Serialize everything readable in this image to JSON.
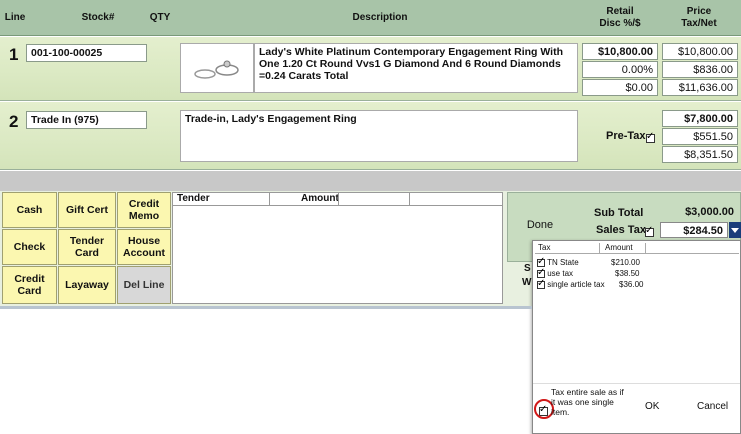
{
  "header": {
    "line": "Line",
    "stock": "Stock#",
    "qty": "QTY",
    "description": "Description",
    "retail": "Retail",
    "disc": "Disc %/$",
    "price": "Price",
    "taxnet": "Tax/Net"
  },
  "lines": [
    {
      "num": "1",
      "stock": "001-100-00025",
      "description": "Lady's White Platinum Contemporary Engagement Ring With One 1.20 Ct Round Vvs1 G Diamond And 6 Round Diamonds =0.24 Carats Total",
      "retail": "$10,800.00",
      "disc_pct": "0.00%",
      "disc_amt": "$0.00",
      "price": "$10,800.00",
      "tax": "$836.00",
      "net": "$11,636.00"
    },
    {
      "num": "2",
      "stock": "Trade In (975)",
      "description": "Trade-in, Lady's Engagement Ring",
      "pretax_label": "Pre-Tax",
      "price": "$7,800.00",
      "tax": "$551.50",
      "net": "$8,351.50"
    }
  ],
  "buttons": {
    "cash": "Cash",
    "gift_cert": "Gift Cert",
    "credit_memo": "Credit Memo",
    "check": "Check",
    "tender_card": "Tender Card",
    "house_account": "House Account",
    "credit_card": "Credit Card",
    "layaway": "Layaway",
    "del_line": "Del Line"
  },
  "tender": {
    "col_tender": "Tender",
    "col_amount": "Amount"
  },
  "done": "Done",
  "totals": {
    "subtotal_label": "Sub Total",
    "subtotal": "$3,000.00",
    "salestax_label": "Sales Tax",
    "salestax": "$284.50"
  },
  "tax_popup": {
    "col_tax": "Tax",
    "col_amount": "Amount",
    "items": [
      {
        "name": "TN State",
        "amount": "$210.00"
      },
      {
        "name": "use tax",
        "amount": "$38.50"
      },
      {
        "name": "single article tax",
        "amount": "$36.00"
      }
    ],
    "entire_sale": "Tax entire sale as if it was one single item.",
    "ok": "OK",
    "cancel": "Cancel"
  },
  "partial_s": "S",
  "partial_w": "W"
}
